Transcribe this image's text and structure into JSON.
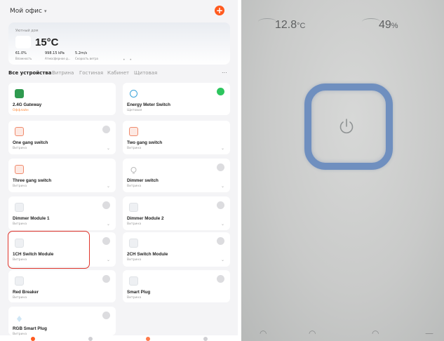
{
  "app": {
    "home_title": "Мой офис",
    "weather": {
      "label": "Уютный дом",
      "temperature": "15°C",
      "stats": [
        {
          "value": "61.0%",
          "label": "Влажность"
        },
        {
          "value": "998.15 kPa",
          "label": "Атмосферное д..."
        },
        {
          "value": "5.2m/s",
          "label": "Скорость ветра"
        }
      ]
    },
    "tabs": [
      {
        "label": "Все устройства",
        "active": true
      },
      {
        "label": "Витрина",
        "active": false
      },
      {
        "label": "Гостиная",
        "active": false
      },
      {
        "label": "Кабинет",
        "active": false
      },
      {
        "label": "Щитовая",
        "active": false
      }
    ],
    "tabs_more": "...",
    "devices": [
      {
        "name": "2.4G Gateway",
        "room": "Оффлайн",
        "offline": true,
        "icon": "gateway-icon",
        "power": "none"
      },
      {
        "name": "Energy Meter Switch",
        "room": "Щитовая",
        "offline": false,
        "icon": "meter-icon",
        "power": "on"
      },
      {
        "name": "One gang switch",
        "room": "Витрина",
        "offline": false,
        "icon": "switch-icon",
        "power": "off"
      },
      {
        "name": "Two gang switch",
        "room": "Витрина",
        "offline": false,
        "icon": "switch-icon",
        "power": "off"
      },
      {
        "name": "Three gang switch",
        "room": "Витрина",
        "offline": false,
        "icon": "switch-icon",
        "power": "off"
      },
      {
        "name": "Dimmer switch",
        "room": "Витрина",
        "offline": false,
        "icon": "bulb-icon",
        "power": "off"
      },
      {
        "name": "Dimmer Module 1",
        "room": "Витрина",
        "offline": false,
        "icon": "module-icon",
        "power": "off"
      },
      {
        "name": "Dimmer Module 2",
        "room": "Витрина",
        "offline": false,
        "icon": "module-icon",
        "power": "off"
      },
      {
        "name": "1CH Switch Module",
        "room": "Витрина",
        "offline": false,
        "icon": "module-icon",
        "power": "off"
      },
      {
        "name": "2CH Switch Module",
        "room": "Витрина",
        "offline": false,
        "icon": "module-icon",
        "power": "off"
      },
      {
        "name": "Red Breaker",
        "room": "Витрина",
        "offline": false,
        "icon": "breaker-icon",
        "power": "off"
      },
      {
        "name": "Smart Plug",
        "room": "Витрина",
        "offline": false,
        "icon": "plug-icon",
        "power": "off"
      },
      {
        "name": "RGB Smart Plug",
        "room": "Витрина",
        "offline": false,
        "icon": "rgb-plug-icon",
        "power": "off"
      }
    ]
  },
  "photo": {
    "temperature": "12.8",
    "temperature_unit": "°C",
    "humidity": "49",
    "humidity_unit": "%"
  },
  "colors": {
    "accent": "#ff5a1f",
    "online_green": "#2dc55e",
    "highlight_red": "#e0362c",
    "switch_frame_blue": "#6f8fbf"
  }
}
